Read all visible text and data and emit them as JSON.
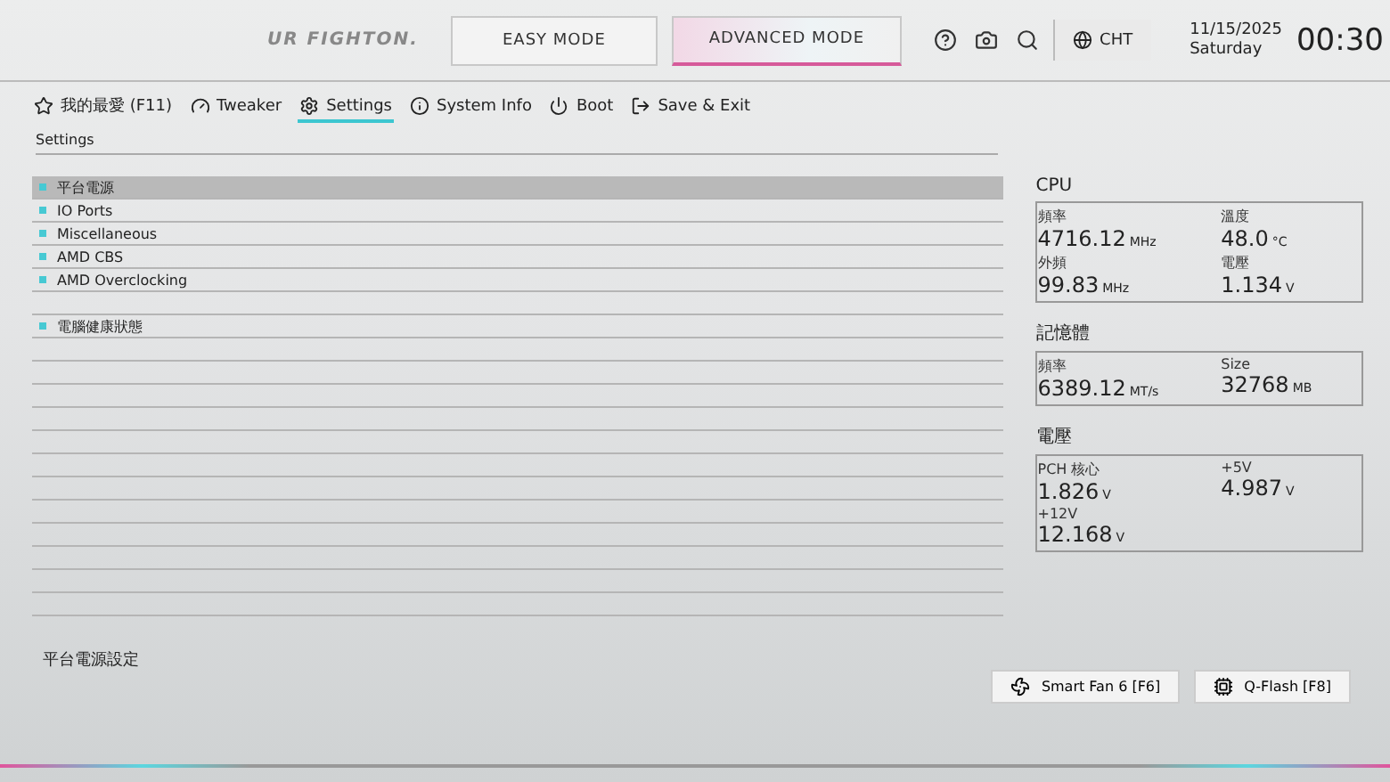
{
  "header": {
    "logo_text": "UR FIGHTON.",
    "modes": [
      {
        "label": "EASY MODE",
        "selected": false
      },
      {
        "label": "ADVANCED MODE",
        "selected": true
      }
    ],
    "language": "CHT",
    "date": "11/15/2025",
    "day": "Saturday",
    "time": "00:30"
  },
  "nav": [
    {
      "label": "我的最愛 (F11)",
      "selected": false
    },
    {
      "label": "Tweaker",
      "selected": false
    },
    {
      "label": "Settings",
      "selected": true
    },
    {
      "label": "System Info",
      "selected": false
    },
    {
      "label": "Boot",
      "selected": false
    },
    {
      "label": "Save & Exit",
      "selected": false
    }
  ],
  "breadcrumb": "Settings",
  "menu": [
    {
      "kind": "item",
      "label": "平台電源",
      "selected": true
    },
    {
      "kind": "item",
      "label": "IO Ports",
      "selected": false
    },
    {
      "kind": "item",
      "label": "Miscellaneous",
      "selected": false
    },
    {
      "kind": "item",
      "label": "AMD CBS",
      "selected": false
    },
    {
      "kind": "item",
      "label": "AMD Overclocking",
      "selected": false
    },
    {
      "kind": "blank"
    },
    {
      "kind": "item",
      "label": "電腦健康狀態",
      "selected": false
    },
    {
      "kind": "blank"
    },
    {
      "kind": "blank"
    },
    {
      "kind": "blank"
    },
    {
      "kind": "blank"
    },
    {
      "kind": "blank"
    },
    {
      "kind": "blank"
    },
    {
      "kind": "blank"
    },
    {
      "kind": "blank"
    },
    {
      "kind": "blank"
    },
    {
      "kind": "blank"
    },
    {
      "kind": "blank"
    },
    {
      "kind": "blank"
    }
  ],
  "help_text": "平台電源設定",
  "monitor": [
    {
      "title": "CPU",
      "stats": [
        {
          "label": "頻率",
          "value": "4716.12",
          "unit": "MHz"
        },
        {
          "label": "溫度",
          "value": "48.0",
          "unit": "°C"
        },
        {
          "label": "外頻",
          "value": "99.83",
          "unit": "MHz"
        },
        {
          "label": "電壓",
          "value": "1.134",
          "unit": "V"
        }
      ]
    },
    {
      "title": "記憶體",
      "stats": [
        {
          "label": "頻率",
          "value": "6389.12",
          "unit": "MT/s"
        },
        {
          "label": "Size",
          "value": "32768",
          "unit": "MB"
        }
      ]
    },
    {
      "title": "電壓",
      "stats": [
        {
          "label": "PCH 核心",
          "value": "1.826",
          "unit": "V"
        },
        {
          "label": "+5V",
          "value": "4.987",
          "unit": "V"
        },
        {
          "label": "+12V",
          "value": "12.168",
          "unit": "V"
        }
      ]
    }
  ],
  "buttons": [
    {
      "label": "Smart Fan 6 [F6]"
    },
    {
      "label": "Q-Flash [F8]"
    }
  ]
}
